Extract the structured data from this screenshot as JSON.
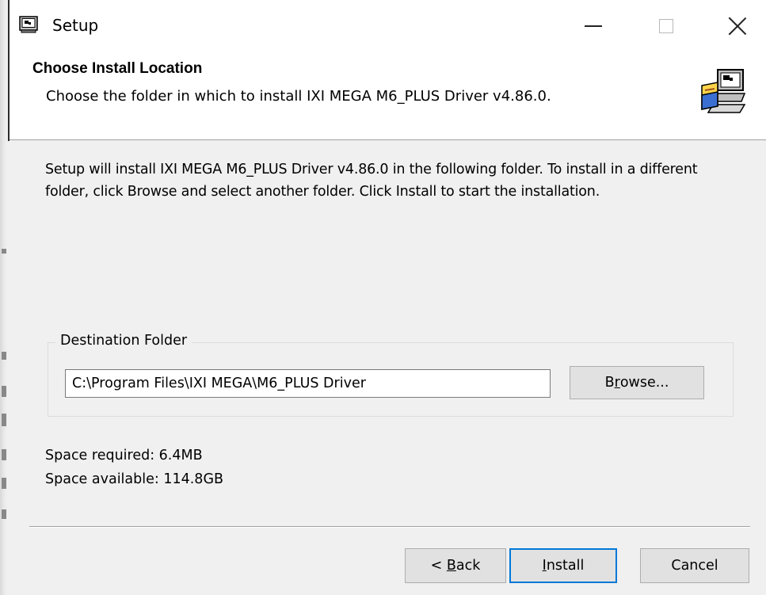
{
  "window": {
    "title": "Setup",
    "icons": {
      "app": "installer-computer-icon",
      "minimize": "minimize-icon",
      "maximize": "maximize-icon",
      "close": "close-icon"
    }
  },
  "header": {
    "title": "Choose Install Location",
    "subtitle": "Choose the folder in which to install IXI MEGA M6_PLUS Driver v4.86.0.",
    "icon": "installer-computer-icon"
  },
  "body": {
    "description": "Setup will install IXI MEGA M6_PLUS Driver v4.86.0 in the following folder. To install in a different folder, click Browse and select another folder. Click Install to start the installation."
  },
  "destination": {
    "group_label": "Destination Folder",
    "path_value": "C:\\Program Files\\IXI MEGA\\M6_PLUS Driver",
    "browse_pre": "B",
    "browse_accel": "r",
    "browse_post": "owse..."
  },
  "space": {
    "required": "Space required: 6.4MB",
    "available": "Space available: 114.8GB"
  },
  "footer": {
    "back_pre": "< ",
    "back_accel": "B",
    "back_post": "ack",
    "install_accel": "I",
    "install_post": "nstall",
    "cancel": "Cancel"
  },
  "colors": {
    "focus_border": "#0078d7",
    "window_bg": "#f0f0f0",
    "header_bg": "#ffffff"
  }
}
